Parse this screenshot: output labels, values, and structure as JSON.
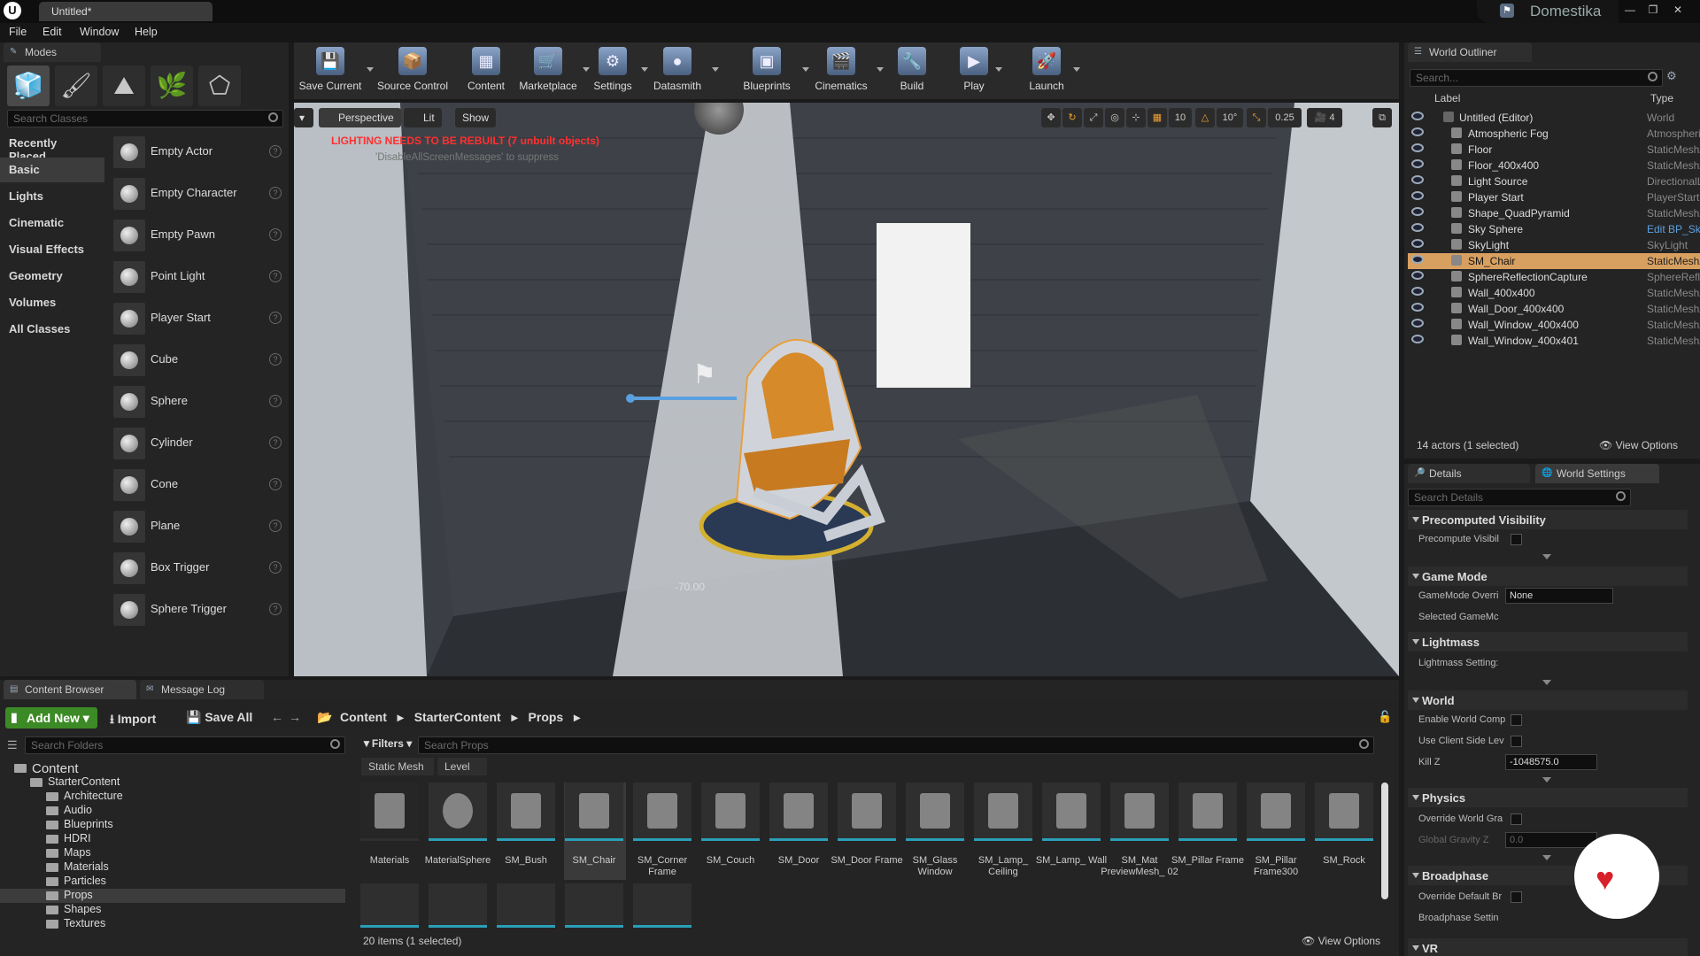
{
  "app": {
    "tab_title": "Untitled*",
    "brand": "Domestika",
    "menu": [
      "File",
      "Edit",
      "Window",
      "Help"
    ]
  },
  "modes": {
    "tab_label": "Modes",
    "search_placeholder": "Search Classes",
    "categories": [
      "Recently Placed",
      "Basic",
      "Lights",
      "Cinematic",
      "Visual Effects",
      "Geometry",
      "Volumes",
      "All Classes"
    ],
    "items": [
      "Empty Actor",
      "Empty Character",
      "Empty Pawn",
      "Point Light",
      "Player Start",
      "Cube",
      "Sphere",
      "Cylinder",
      "Cone",
      "Plane",
      "Box Trigger",
      "Sphere Trigger"
    ]
  },
  "toolbar": {
    "buttons": [
      "Save Current",
      "Source Control",
      "Content",
      "Marketplace",
      "Settings",
      "Datasmith",
      "Blueprints",
      "Cinematics",
      "Build",
      "Play",
      "Launch"
    ]
  },
  "viewport": {
    "perspective": "Perspective",
    "lit": "Lit",
    "show": "Show",
    "warning": "LIGHTING NEEDS TO BE REBUILT (7 unbuilt objects)",
    "suppress_hint": "'DisableAllScreenMessages' to suppress",
    "grid": "10",
    "angle": "10°",
    "scale": "0.25",
    "camera_speed": "4",
    "rotation_readout": "-70.00"
  },
  "outliner": {
    "tab_label": "World Outliner",
    "search_placeholder": "Search...",
    "col_label": "Label",
    "col_type": "Type",
    "rows": [
      {
        "name": "Untitled (Editor)",
        "type": "World"
      },
      {
        "name": "Atmospheric Fog",
        "type": "AtmosphericFog"
      },
      {
        "name": "Floor",
        "type": "StaticMeshActor"
      },
      {
        "name": "Floor_400x400",
        "type": "StaticMeshActor"
      },
      {
        "name": "Light Source",
        "type": "DirectionalLight"
      },
      {
        "name": "Player Start",
        "type": "PlayerStart"
      },
      {
        "name": "Shape_QuadPyramid",
        "type": "StaticMeshActor"
      },
      {
        "name": "Sky Sphere",
        "type": "Edit BP_Sky_Sphere"
      },
      {
        "name": "SkyLight",
        "type": "SkyLight"
      },
      {
        "name": "SM_Chair",
        "type": "StaticMeshActor"
      },
      {
        "name": "SphereReflectionCapture",
        "type": "SphereReflectionCapture"
      },
      {
        "name": "Wall_400x400",
        "type": "StaticMeshActor"
      },
      {
        "name": "Wall_Door_400x400",
        "type": "StaticMeshActor"
      },
      {
        "name": "Wall_Window_400x400",
        "type": "StaticMeshActor"
      },
      {
        "name": "Wall_Window_400x401",
        "type": "StaticMeshActor"
      }
    ],
    "selected_row": "SM_Chair",
    "count": "14 actors (1 selected)",
    "view_options": "View Options"
  },
  "details": {
    "tab_details": "Details",
    "tab_world": "World Settings",
    "search_placeholder": "Search Details",
    "sections": {
      "precomputed": "Precomputed Visibility",
      "precompute_visibility": "Precompute Visibil",
      "game_mode": "Game Mode",
      "gamemode_override": "GameMode Overri",
      "gamemode_value": "None",
      "selected_gamemode": "Selected GameMc",
      "lightmass": "Lightmass",
      "lightmass_settings": "Lightmass Setting:",
      "world": "World",
      "enable_world_comp": "Enable World Comp",
      "use_client_side": "Use Client Side Lev",
      "kill_z": "Kill Z",
      "kill_z_value": "-1048575.0",
      "physics": "Physics",
      "override_world_gravity": "Override World Gra",
      "global_gravity": "Global Gravity Z",
      "global_gravity_value": "0.0",
      "broadphase": "Broadphase",
      "override_default_broadphase": "Override Default Br",
      "broadphase_settings": "Broadphase Settin",
      "vr": "VR"
    }
  },
  "content_browser": {
    "tab_label": "Content Browser",
    "tab_message_log": "Message Log",
    "add_new": "Add New",
    "import": "Import",
    "save_all": "Save All",
    "breadcrumb": [
      "Content",
      "StarterContent",
      "Props"
    ],
    "folder_search": "Search Folders",
    "asset_search": "Search Props",
    "filters": "Filters",
    "filter_chips": [
      "Static Mesh",
      "Level"
    ],
    "tree": [
      "Content",
      "StarterContent",
      "Architecture",
      "Audio",
      "Blueprints",
      "HDRI",
      "Maps",
      "Materials",
      "Particles",
      "Props",
      "Shapes",
      "Textures"
    ],
    "assets": [
      "Materials",
      "MaterialSphere",
      "SM_Bush",
      "SM_Chair",
      "SM_Corner Frame",
      "SM_Couch",
      "SM_Door",
      "SM_Door Frame",
      "SM_Glass Window",
      "SM_Lamp_ Ceiling",
      "SM_Lamp_ Wall",
      "SM_Mat PreviewMesh_ 02",
      "SM_Pillar Frame",
      "SM_Pillar Frame300",
      "SM_Rock"
    ],
    "status": "20 items (1 selected)",
    "view_options": "View Options"
  },
  "colors": {
    "accent_orange": "#e8a040",
    "selection_row": "#d8a060",
    "add_new_green": "#3c8a25",
    "warning_red": "#ff3030"
  }
}
